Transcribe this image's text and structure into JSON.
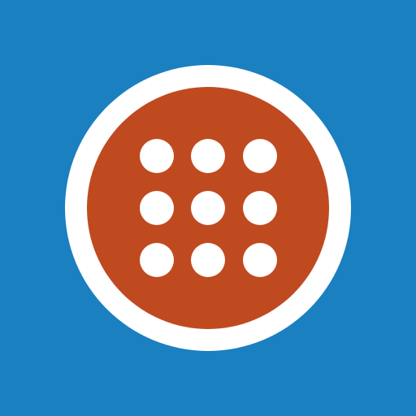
{
  "icon": {
    "name": "app-grid-icon",
    "colors": {
      "background": "#1a80c0",
      "ring": "#ffffff",
      "disc": "#c04a1f",
      "dot": "#ffffff"
    },
    "grid": {
      "rows": 3,
      "columns": 3
    }
  }
}
